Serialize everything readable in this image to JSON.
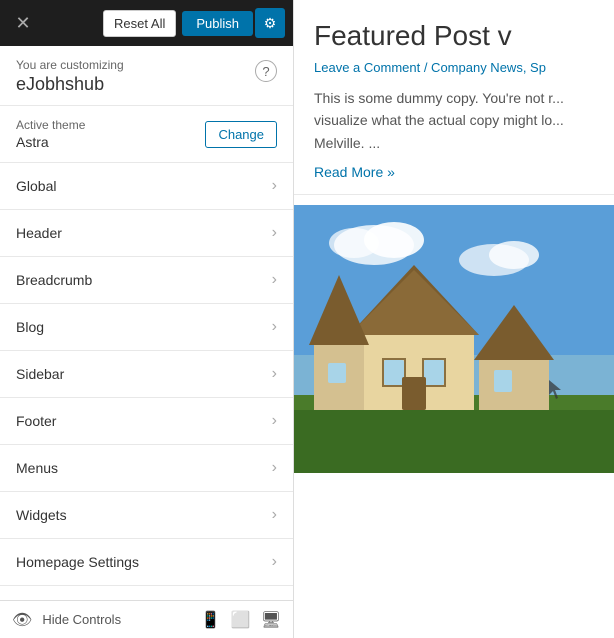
{
  "topBar": {
    "resetLabel": "Reset All",
    "publishLabel": "Publish",
    "gearIcon": "⚙"
  },
  "customizing": {
    "label": "You are customizing",
    "siteName": "eJobhshub",
    "helpIcon": "?"
  },
  "theme": {
    "label": "Active theme",
    "name": "Astra",
    "changeLabel": "Change"
  },
  "navItems": [
    {
      "label": "Global"
    },
    {
      "label": "Header"
    },
    {
      "label": "Breadcrumb"
    },
    {
      "label": "Blog"
    },
    {
      "label": "Sidebar"
    },
    {
      "label": "Footer"
    },
    {
      "label": "Menus"
    },
    {
      "label": "Widgets"
    },
    {
      "label": "Homepage Settings"
    }
  ],
  "bottomBar": {
    "hideControls": "Hide Controls"
  },
  "preview": {
    "postTitle": "Featured Post v",
    "postMeta": "Leave a Comment / Company News, Sp",
    "excerpt": "This is some dummy copy. You're not r... visualize what the actual copy might lo... Melville. ...",
    "readMore": "Read More »"
  }
}
